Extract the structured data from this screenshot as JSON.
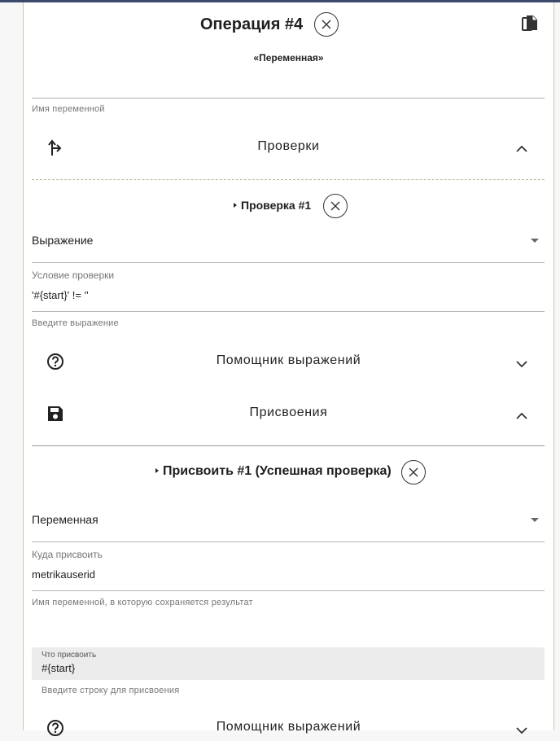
{
  "operation": {
    "title": "Операция #4",
    "subtitle": "«Переменная»",
    "name_helper": "Имя переменной"
  },
  "checks": {
    "section_title": "Проверки",
    "item_title": "Проверка #1",
    "type_value": "Выражение",
    "condition_label": "Условие проверки",
    "condition_value": "'#{start}' != ''",
    "condition_helper": "Введите выражение",
    "expr_helper_title": "Помощник выражений"
  },
  "assignments": {
    "section_title": "Присвоения",
    "item_title": "Присвоить #1 (Успешная проверка)",
    "type_value": "Переменная",
    "target_label": "Куда присвоить",
    "target_value": "metrikauserid",
    "target_helper": "Имя переменной, в которую сохраняется результат",
    "what_label": "Что присвоить",
    "what_value": "#{start}",
    "what_helper": "Введите строку для присвоения",
    "expr_helper_title": "Помощник выражений"
  },
  "icons": [
    "copy-icon",
    "close-icon",
    "branch-icon",
    "chevron-up-icon",
    "help-circle-icon",
    "chevron-down-icon",
    "save-icon",
    "caret-right-icon",
    "dropdown-arrow-icon"
  ]
}
